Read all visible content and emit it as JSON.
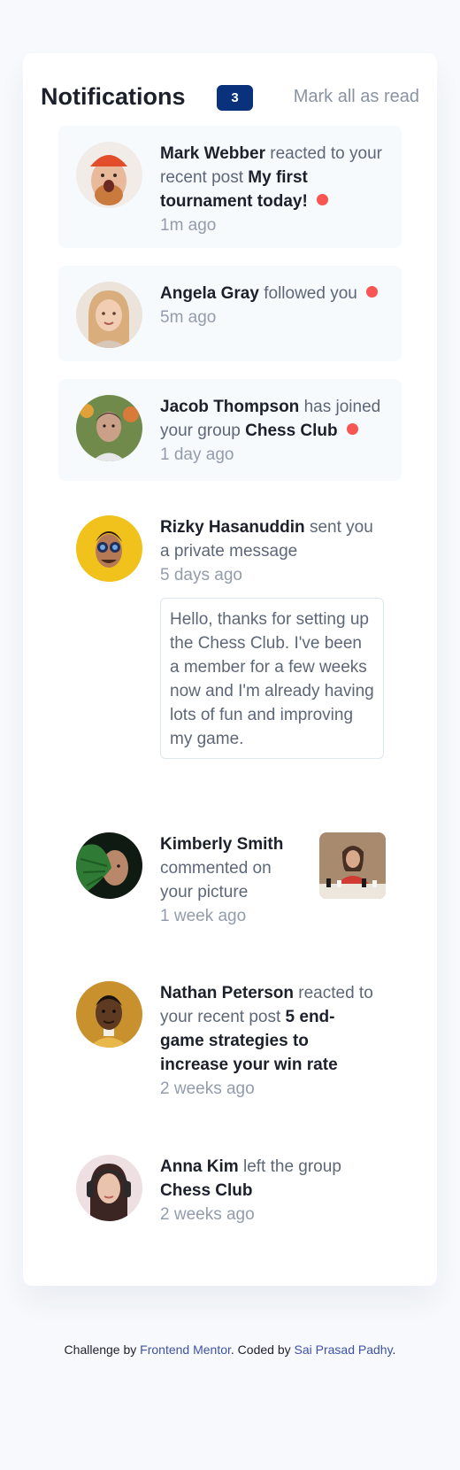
{
  "header": {
    "title": "Notifications",
    "unread_count": "3",
    "mark_all_label": "Mark all as read"
  },
  "notifications": [
    {
      "name": "Mark Webber",
      "action": "reacted to your recent post",
      "target": "My first tournament today!",
      "time": "1m ago",
      "unread": true
    },
    {
      "name": "Angela Gray",
      "action": "followed you",
      "time": "5m ago",
      "unread": true
    },
    {
      "name": "Jacob Thompson",
      "action": "has joined your group",
      "target": "Chess Club",
      "time": "1 day ago",
      "unread": true
    },
    {
      "name": "Rizky Hasanuddin",
      "action": "sent you a private message",
      "time": "5 days ago",
      "message": "Hello, thanks for setting up the Chess Club. I've been a member for a few weeks now and I'm already having lots of fun and improving my game.",
      "unread": false
    },
    {
      "name": "Kimberly Smith",
      "action": "commented on your picture",
      "time": "1 week ago",
      "unread": false
    },
    {
      "name": "Nathan Peterson",
      "action": "reacted to your recent post",
      "target": "5 end-game strategies to increase your win rate",
      "time": "2 weeks ago",
      "unread": false
    },
    {
      "name": "Anna Kim",
      "action": "left the group",
      "target": "Chess Club",
      "time": "2 weeks ago",
      "unread": false
    }
  ],
  "footer": {
    "prefix": "Challenge by",
    "link1": "Frontend Mentor",
    "middle": ". Coded by",
    "link2": "Sai Prasad Padhy",
    "suffix": "."
  },
  "colors": {
    "unread_dot": "#f65552",
    "badge_bg": "#0a317b",
    "unread_bg": "#f7fafd",
    "link": "#3e52a3"
  }
}
